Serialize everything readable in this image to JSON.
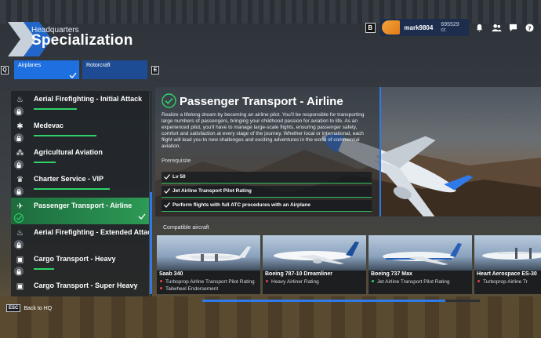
{
  "header": {
    "subtitle": "Headquarters",
    "title": "Specialization"
  },
  "topbar": {
    "b_key": "B",
    "username": "mark9804",
    "credits": "695529 cr."
  },
  "tabs": {
    "prev_key": "Q",
    "next_key": "E",
    "items": [
      {
        "label": "Airplanes",
        "active": true
      },
      {
        "label": "Rotorcraft",
        "active": false
      }
    ]
  },
  "specializations": [
    {
      "label": "Aerial Firefighting - Initial Attack",
      "icon": "fire-icon",
      "progress": 0.4,
      "active": false
    },
    {
      "label": "Medevac",
      "icon": "medical-star-icon",
      "progress": 0.55,
      "active": false
    },
    {
      "label": "Agricultural Aviation",
      "icon": "crop-icon",
      "progress": 0.2,
      "active": false
    },
    {
      "label": "Charter Service - VIP",
      "icon": "crown-icon",
      "progress": 0.65,
      "active": false
    },
    {
      "label": "Passenger Transport - Airline",
      "icon": "airliner-icon",
      "progress": 0.0,
      "active": true
    },
    {
      "label": "Aerial Firefighting - Extended Attack",
      "icon": "fire-icon",
      "progress": 0.0,
      "active": false
    },
    {
      "label": "Cargo Transport - Heavy",
      "icon": "cargo-box-icon",
      "progress": 0.15,
      "active": false
    },
    {
      "label": "Cargo Transport - Super Heavy",
      "icon": "cargo-box-icon",
      "progress": 0.0,
      "active": false
    }
  ],
  "detail": {
    "title": "Passenger Transport - Airline",
    "description": "Realize a lifelong dream by becoming an airline pilot. You'll be responsible for transporting large numbers of passengers, bringing your childhood passion for aviation to life. As an experienced pilot, you'll have to manage large-scale flights, ensuring passenger safety, comfort and satisfaction at every stage of the journey. Whether local or international, each flight will lead you to new challenges and exciting adventures in the world of commercial aviation.",
    "prerequisite_label": "Prerequisite",
    "prerequisites": [
      "Lv 50",
      "Jet Airline Transport Pilot Rating",
      "Perform flights with full ATC procedures with an Airplane"
    ]
  },
  "compatible": {
    "label": "Compatible aircraft",
    "aircraft": [
      {
        "name": "Saab 340",
        "requirements": [
          {
            "text": "Turboprop Airline Transport Pilot Rating",
            "status": "missing"
          },
          {
            "text": "Tailwheel Endorsement",
            "status": "missing"
          }
        ]
      },
      {
        "name": "Boeing 787-10 Dreamliner",
        "requirements": [
          {
            "text": "Heavy Airliner Rating",
            "status": "missing"
          }
        ]
      },
      {
        "name": "Boeing 737 Max",
        "requirements": [
          {
            "text": "Jet Airline Transport Pilot Rating",
            "status": "met"
          }
        ]
      },
      {
        "name": "Heart Aerospace ES-30",
        "requirements": [
          {
            "text": "Turboprop Airline Tr",
            "status": "missing"
          }
        ]
      }
    ]
  },
  "footer": {
    "esc_key": "ESC",
    "back_label": "Back to HQ"
  },
  "colors": {
    "accent_blue": "#1e6fe0",
    "progress_green": "#30d26a",
    "missing_red": "#e8404a",
    "met_green": "#30d26a"
  }
}
